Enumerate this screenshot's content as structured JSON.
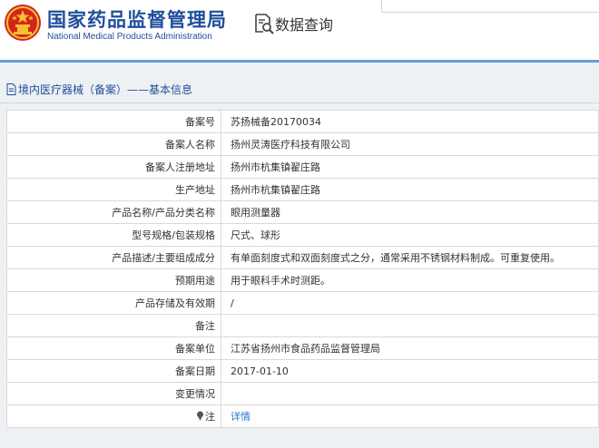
{
  "header": {
    "agency_name_cn": "国家药品监督管理局",
    "agency_name_en": "National Medical Products Administration",
    "query_label": "数据查询",
    "emblem_icon": "national-emblem-icon",
    "query_icon": "document-search-icon",
    "brand_color": "#1f4e9a",
    "accent_rule_color": "#5d9fd8"
  },
  "breadcrumb": {
    "icon": "document-icon",
    "text": "境内医疗器械（备案）——基本信息"
  },
  "record": {
    "rows": [
      {
        "label": "备案号",
        "value": "苏扬械备20170034"
      },
      {
        "label": "备案人名称",
        "value": "扬州灵涛医疗科技有限公司"
      },
      {
        "label": "备案人注册地址",
        "value": "扬州市杭集镇翟庄路"
      },
      {
        "label": "生产地址",
        "value": "扬州市杭集镇翟庄路"
      },
      {
        "label": "产品名称/产品分类名称",
        "value": "眼用测量器"
      },
      {
        "label": "型号规格/包装规格",
        "value": "尺式、球形"
      },
      {
        "label": "产品描述/主要组成成分",
        "value": "有单面刻度式和双面刻度式之分，通常采用不锈钢材料制成。可重复使用。"
      },
      {
        "label": "预期用途",
        "value": "用于眼科手术时测距。"
      },
      {
        "label": "产品存储及有效期",
        "value": "/"
      },
      {
        "label": "备注",
        "value": ""
      },
      {
        "label": "备案单位",
        "value": "江苏省扬州市食品药品监督管理局"
      },
      {
        "label": "备案日期",
        "value": "2017-01-10"
      },
      {
        "label": "变更情况",
        "value": ""
      }
    ],
    "note_row": {
      "label": "注",
      "icon": "pin-icon",
      "link_text": "详情",
      "link_color": "#2b77c8"
    }
  }
}
